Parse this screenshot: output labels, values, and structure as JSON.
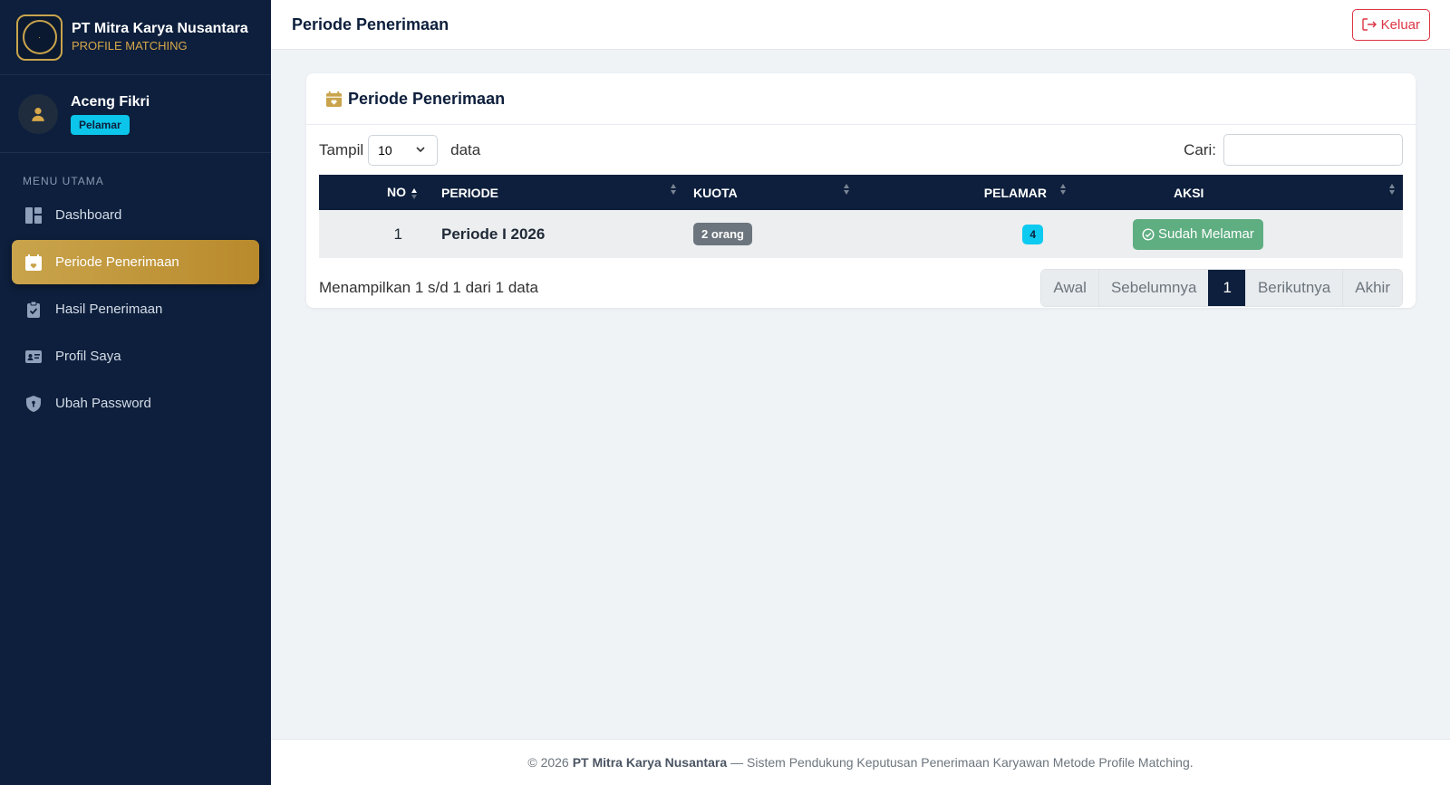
{
  "brand": {
    "name": "PT Mitra Karya Nusantara",
    "subtitle": "PROFILE MATCHING"
  },
  "user": {
    "name": "Aceng Fikri",
    "role": "Pelamar"
  },
  "sidebar": {
    "section_title": "MENU UTAMA",
    "items": [
      {
        "label": "Dashboard",
        "icon": "dashboard-icon"
      },
      {
        "label": "Periode Penerimaan",
        "icon": "calendar-icon",
        "active": true
      },
      {
        "label": "Hasil Penerimaan",
        "icon": "clipboard-icon"
      },
      {
        "label": "Profil Saya",
        "icon": "id-card-icon"
      },
      {
        "label": "Ubah Password",
        "icon": "shield-icon"
      }
    ]
  },
  "header": {
    "title": "Periode Penerimaan",
    "logout_label": "Keluar"
  },
  "card": {
    "title": "Periode Penerimaan"
  },
  "table_controls": {
    "show_label": "Tampil",
    "page_size": "10",
    "page_size_options": [
      "10"
    ],
    "data_label": "data",
    "search_label": "Cari:",
    "search_value": ""
  },
  "table": {
    "columns": [
      "NO",
      "PERIODE",
      "KUOTA",
      "PELAMAR",
      "AKSI"
    ],
    "rows": [
      {
        "no": "1",
        "periode": "Periode I 2026",
        "kuota": "2 orang",
        "pelamar": "4",
        "aksi": "Sudah Melamar"
      }
    ]
  },
  "pagination": {
    "info": "Menampilkan 1 s/d 1 dari 1 data",
    "first": "Awal",
    "prev": "Sebelumnya",
    "current": "1",
    "next": "Berikutnya",
    "last": "Akhir"
  },
  "footer": {
    "copyright": "© 2026",
    "company": "PT Mitra Karya Nusantara",
    "text": "— Sistem Pendukung Keputusan Penerimaan Karyawan Metode Profile Matching."
  },
  "colors": {
    "sidebar": "#0d1f3c",
    "accent_gold": "#c9a44c",
    "danger": "#dc3545",
    "success": "#5fae82",
    "info": "#0dcaf0"
  }
}
